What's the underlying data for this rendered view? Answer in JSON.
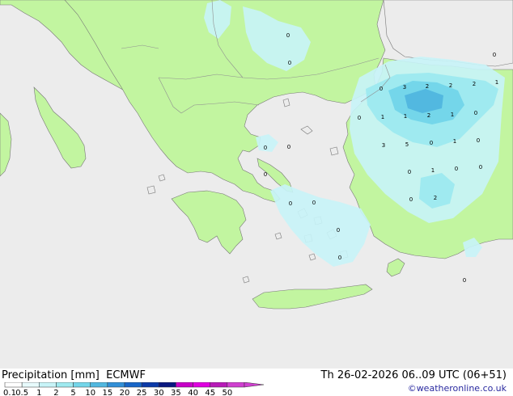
{
  "header": {
    "title": "Precipitation [mm]  ECMWF",
    "datetime": "Th 26-02-2026 06..09 UTC (06+51)",
    "credit": "©weatheronline.co.uk"
  },
  "colors": {
    "sea": "#ececec",
    "land": "#c2f5a0",
    "coast": "#777777",
    "border": "#909090"
  },
  "legend": {
    "labels": [
      "0.1",
      "0.5",
      "1",
      "2",
      "5",
      "10",
      "15",
      "20",
      "25",
      "30",
      "35",
      "40",
      "45",
      "50"
    ],
    "colors": [
      "#ffffff",
      "#e8fbfc",
      "#c8f4f8",
      "#9feaf0",
      "#74d6ea",
      "#52b8e0",
      "#3290d8",
      "#1866c8",
      "#0c3aa8",
      "#0a1880",
      "#c800c8",
      "#e000e0",
      "#b81ab8",
      "#d040d0"
    ]
  },
  "map_labels": [
    {
      "id": "p01",
      "text": "0"
    },
    {
      "id": "p02",
      "text": "0"
    },
    {
      "id": "p03",
      "text": "0"
    },
    {
      "id": "p04",
      "text": "0"
    },
    {
      "id": "p05",
      "text": "1"
    },
    {
      "id": "p06",
      "text": "3"
    },
    {
      "id": "p07",
      "text": "2"
    },
    {
      "id": "p08",
      "text": "2"
    },
    {
      "id": "p09",
      "text": "2"
    },
    {
      "id": "p10",
      "text": "1"
    },
    {
      "id": "p11",
      "text": "0"
    },
    {
      "id": "p12",
      "text": "1"
    },
    {
      "id": "p13",
      "text": "1"
    },
    {
      "id": "p14",
      "text": "2"
    },
    {
      "id": "p15",
      "text": "1"
    },
    {
      "id": "p16",
      "text": "0"
    },
    {
      "id": "p17",
      "text": "0"
    },
    {
      "id": "p18",
      "text": "0"
    },
    {
      "id": "p19",
      "text": "0"
    },
    {
      "id": "p20",
      "text": "3"
    },
    {
      "id": "p21",
      "text": "5"
    },
    {
      "id": "p22",
      "text": "0"
    },
    {
      "id": "p23",
      "text": "1"
    },
    {
      "id": "p24",
      "text": "0"
    },
    {
      "id": "p25",
      "text": "0"
    },
    {
      "id": "p26",
      "text": "0"
    },
    {
      "id": "p27",
      "text": "1"
    },
    {
      "id": "p28",
      "text": "0"
    },
    {
      "id": "p29",
      "text": "0"
    },
    {
      "id": "p30",
      "text": "0"
    },
    {
      "id": "p31",
      "text": "0"
    },
    {
      "id": "p32",
      "text": "2"
    },
    {
      "id": "p33",
      "text": "0"
    },
    {
      "id": "p34",
      "text": "0"
    },
    {
      "id": "p35",
      "text": "0"
    }
  ]
}
